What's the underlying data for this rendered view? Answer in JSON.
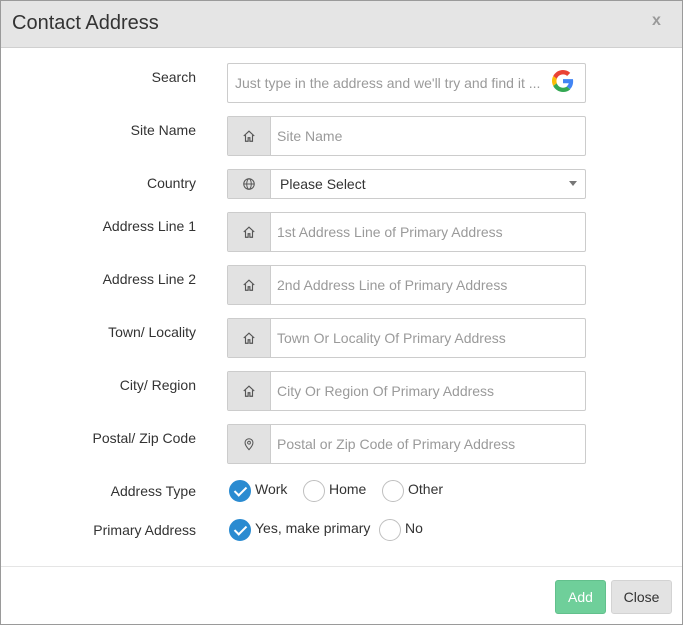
{
  "modal": {
    "title": "Contact Address",
    "close_glyph": "x"
  },
  "form": {
    "search": {
      "label": "Search",
      "placeholder": "Just type in the address and we'll try and find it ...",
      "icon": "google-icon"
    },
    "site_name": {
      "label": "Site Name",
      "placeholder": "Site Name",
      "icon": "home-icon"
    },
    "country": {
      "label": "Country",
      "value": "Please Select",
      "icon": "globe-icon"
    },
    "address_line_1": {
      "label": "Address Line 1",
      "placeholder": "1st Address Line of Primary Address",
      "icon": "home-icon"
    },
    "address_line_2": {
      "label": "Address Line 2",
      "placeholder": "2nd Address Line of Primary Address",
      "icon": "home-icon"
    },
    "town": {
      "label": "Town/ Locality",
      "placeholder": "Town Or Locality Of Primary Address",
      "icon": "home-icon"
    },
    "city": {
      "label": "City/ Region",
      "placeholder": "City Or Region Of Primary Address",
      "icon": "home-icon"
    },
    "postal": {
      "label": "Postal/ Zip Code",
      "placeholder": "Postal or Zip Code of Primary Address",
      "icon": "map-pin-icon"
    },
    "address_type": {
      "label": "Address Type",
      "options": [
        {
          "label": "Work",
          "checked": true
        },
        {
          "label": "Home",
          "checked": false
        },
        {
          "label": "Other",
          "checked": false
        }
      ]
    },
    "primary_address": {
      "label": "Primary Address",
      "options": [
        {
          "label": "Yes, make primary",
          "checked": true
        },
        {
          "label": "No",
          "checked": false
        }
      ]
    }
  },
  "footer": {
    "add_label": "Add",
    "close_label": "Close"
  },
  "colors": {
    "primary_check": "#2a8bd1",
    "add_button": "#6fcf9a",
    "header_bg": "#e5e5e5"
  }
}
